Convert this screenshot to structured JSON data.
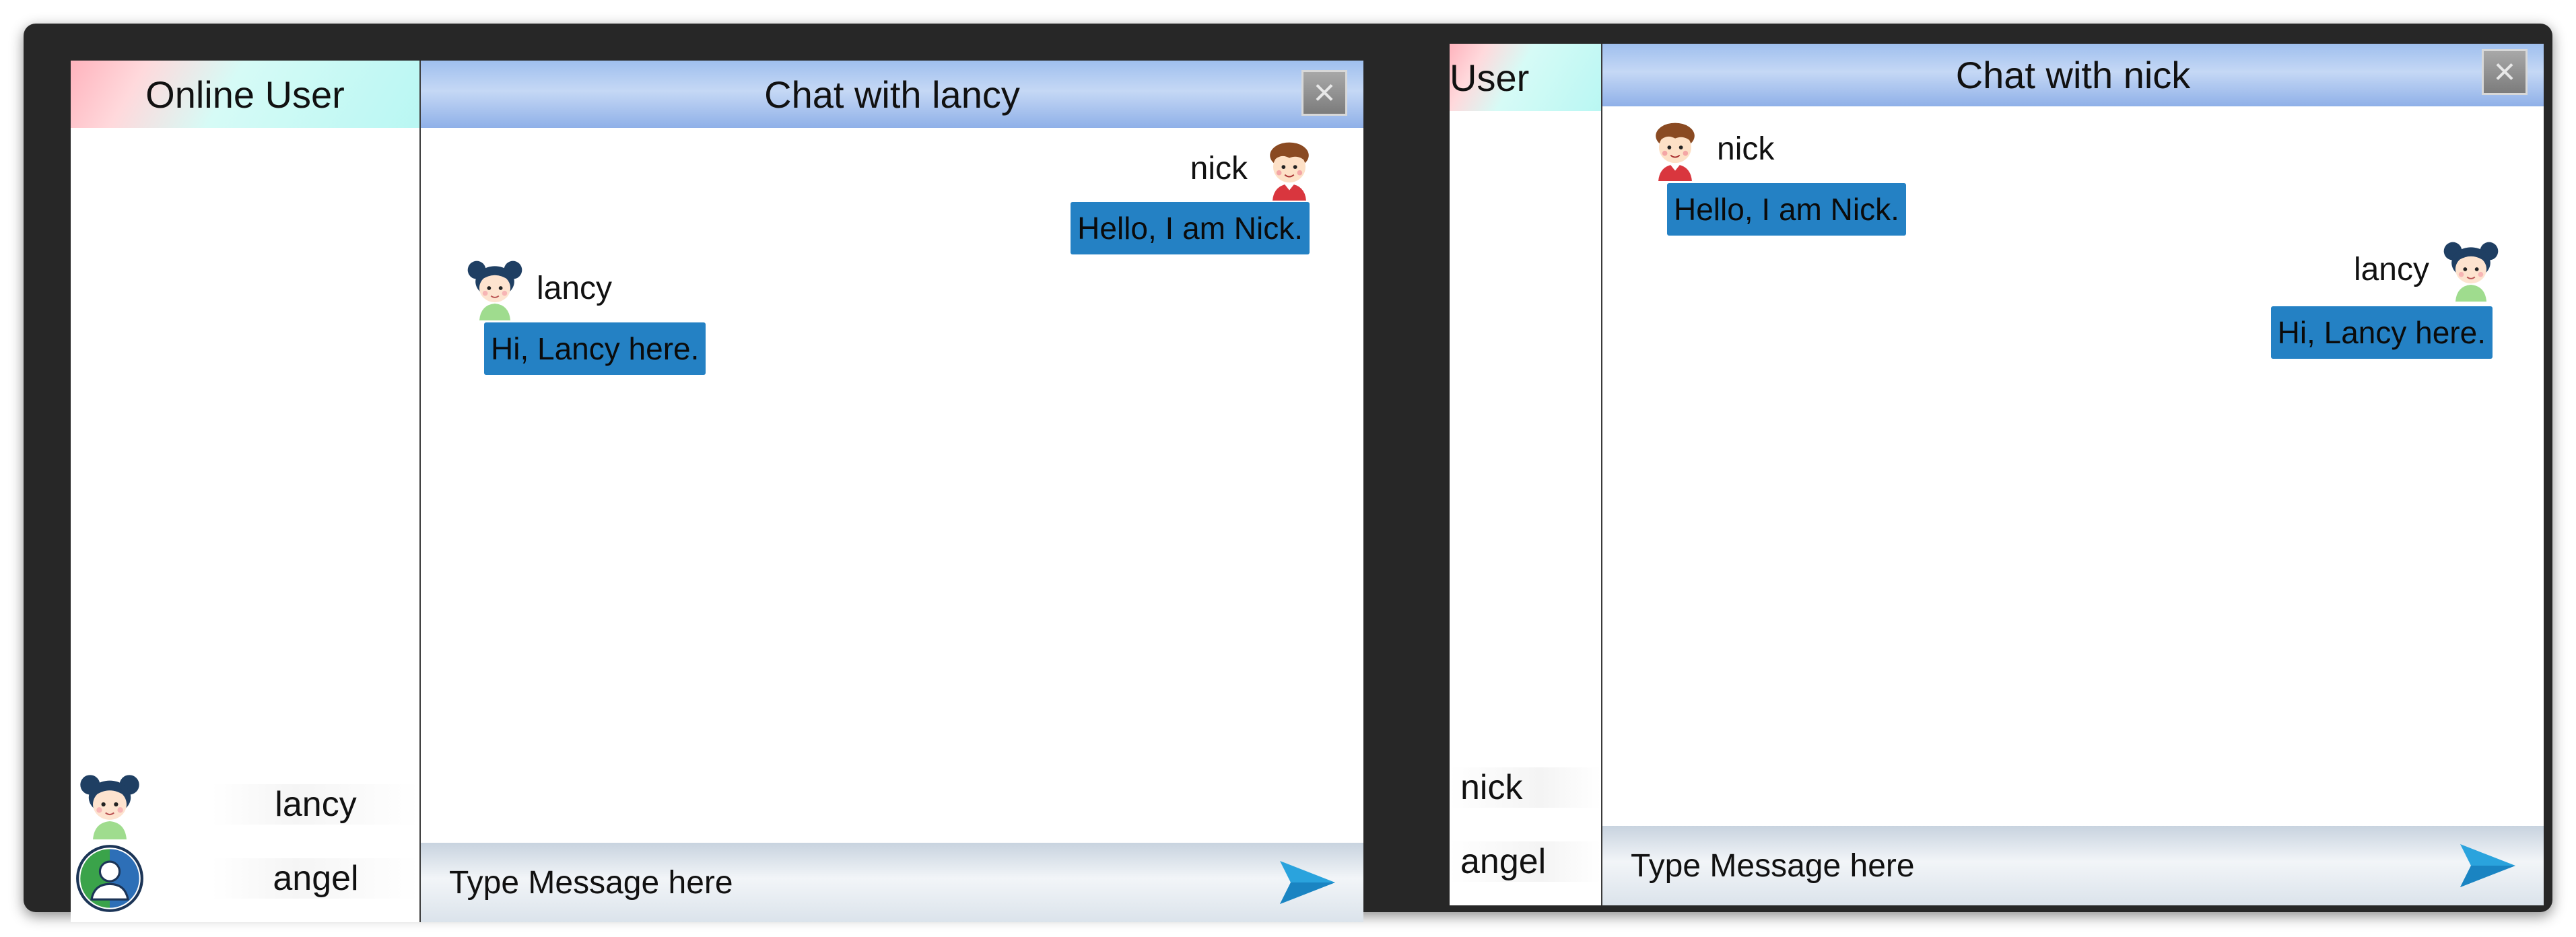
{
  "left_window": {
    "sidebar_title": "Online User",
    "users": [
      {
        "name": "lancy",
        "avatar": "girl-avatar-icon"
      },
      {
        "name": "angel",
        "avatar": "default-user-icon"
      }
    ],
    "chat_title": "Chat with lancy",
    "messages": [
      {
        "sender": "nick",
        "text": "Hello, I am Nick.",
        "side": "right"
      },
      {
        "sender": "lancy",
        "text": "Hi, Lancy here.",
        "side": "left"
      }
    ],
    "input_placeholder": "Type Message here"
  },
  "right_window": {
    "sidebar_title": "User",
    "users": [
      {
        "name": "nick"
      },
      {
        "name": "angel"
      }
    ],
    "chat_title": "Chat with nick",
    "messages": [
      {
        "sender": "nick",
        "text": "Hello, I am Nick.",
        "side": "left"
      },
      {
        "sender": "lancy",
        "text": "Hi, Lancy here.",
        "side": "right"
      }
    ],
    "input_placeholder": "Type Message here"
  },
  "colors": {
    "bubble": "#2481c4",
    "header": "#9fbfee",
    "background": "#272727"
  },
  "icons": {
    "close": "close-icon",
    "send": "send-icon"
  }
}
